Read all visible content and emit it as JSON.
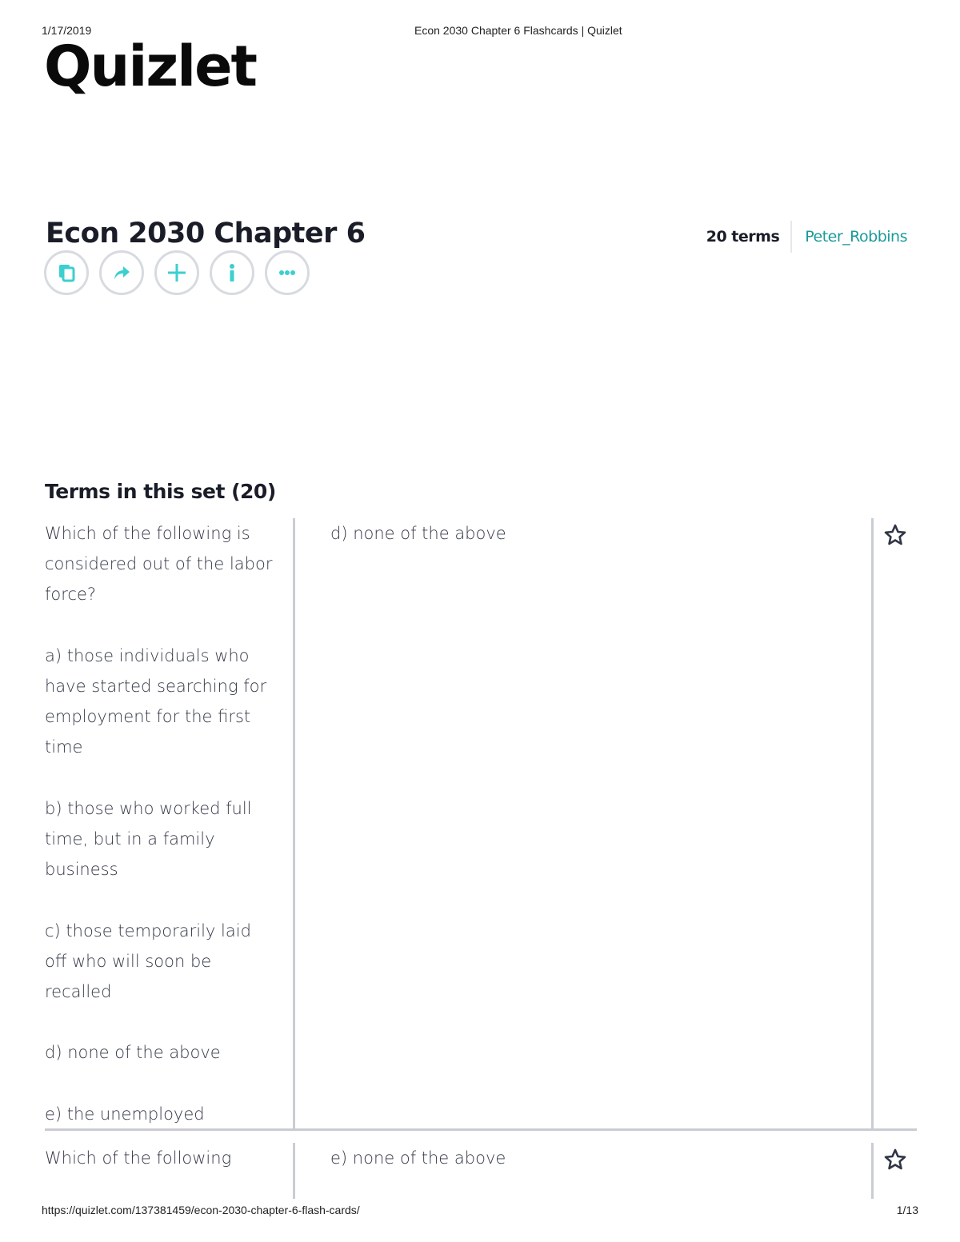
{
  "print_header": {
    "date": "1/17/2019",
    "title": "Econ 2030 Chapter 6 Flashcards | Quizlet"
  },
  "logo": "Quizlet",
  "set": {
    "title": "Econ 2030 Chapter 6",
    "terms_count": "20 terms",
    "author": "Peter_Robbins"
  },
  "actions": [
    {
      "icon": "copy-icon"
    },
    {
      "icon": "share-icon"
    },
    {
      "icon": "add-icon"
    },
    {
      "icon": "info-icon"
    },
    {
      "icon": "more-icon"
    }
  ],
  "accent_color": "#3ccfcf",
  "terms_heading": "Terms in this set (20)",
  "cards": [
    {
      "term": "Which of the following is considered out of the labor force?\n\na) those individuals who have started searching for employment for the first time\n\nb) those who worked full time, but in a family business\n\nc) those temporarily laid off who will soon be recalled\n\nd) none of the above\n\ne) the unemployed",
      "definition": "d) none of the above"
    },
    {
      "term": "Which of the following",
      "definition": "e) none of the above"
    }
  ],
  "print_footer": {
    "url": "https://quizlet.com/137381459/econ-2030-chapter-6-flash-cards/",
    "page": "1/13"
  }
}
